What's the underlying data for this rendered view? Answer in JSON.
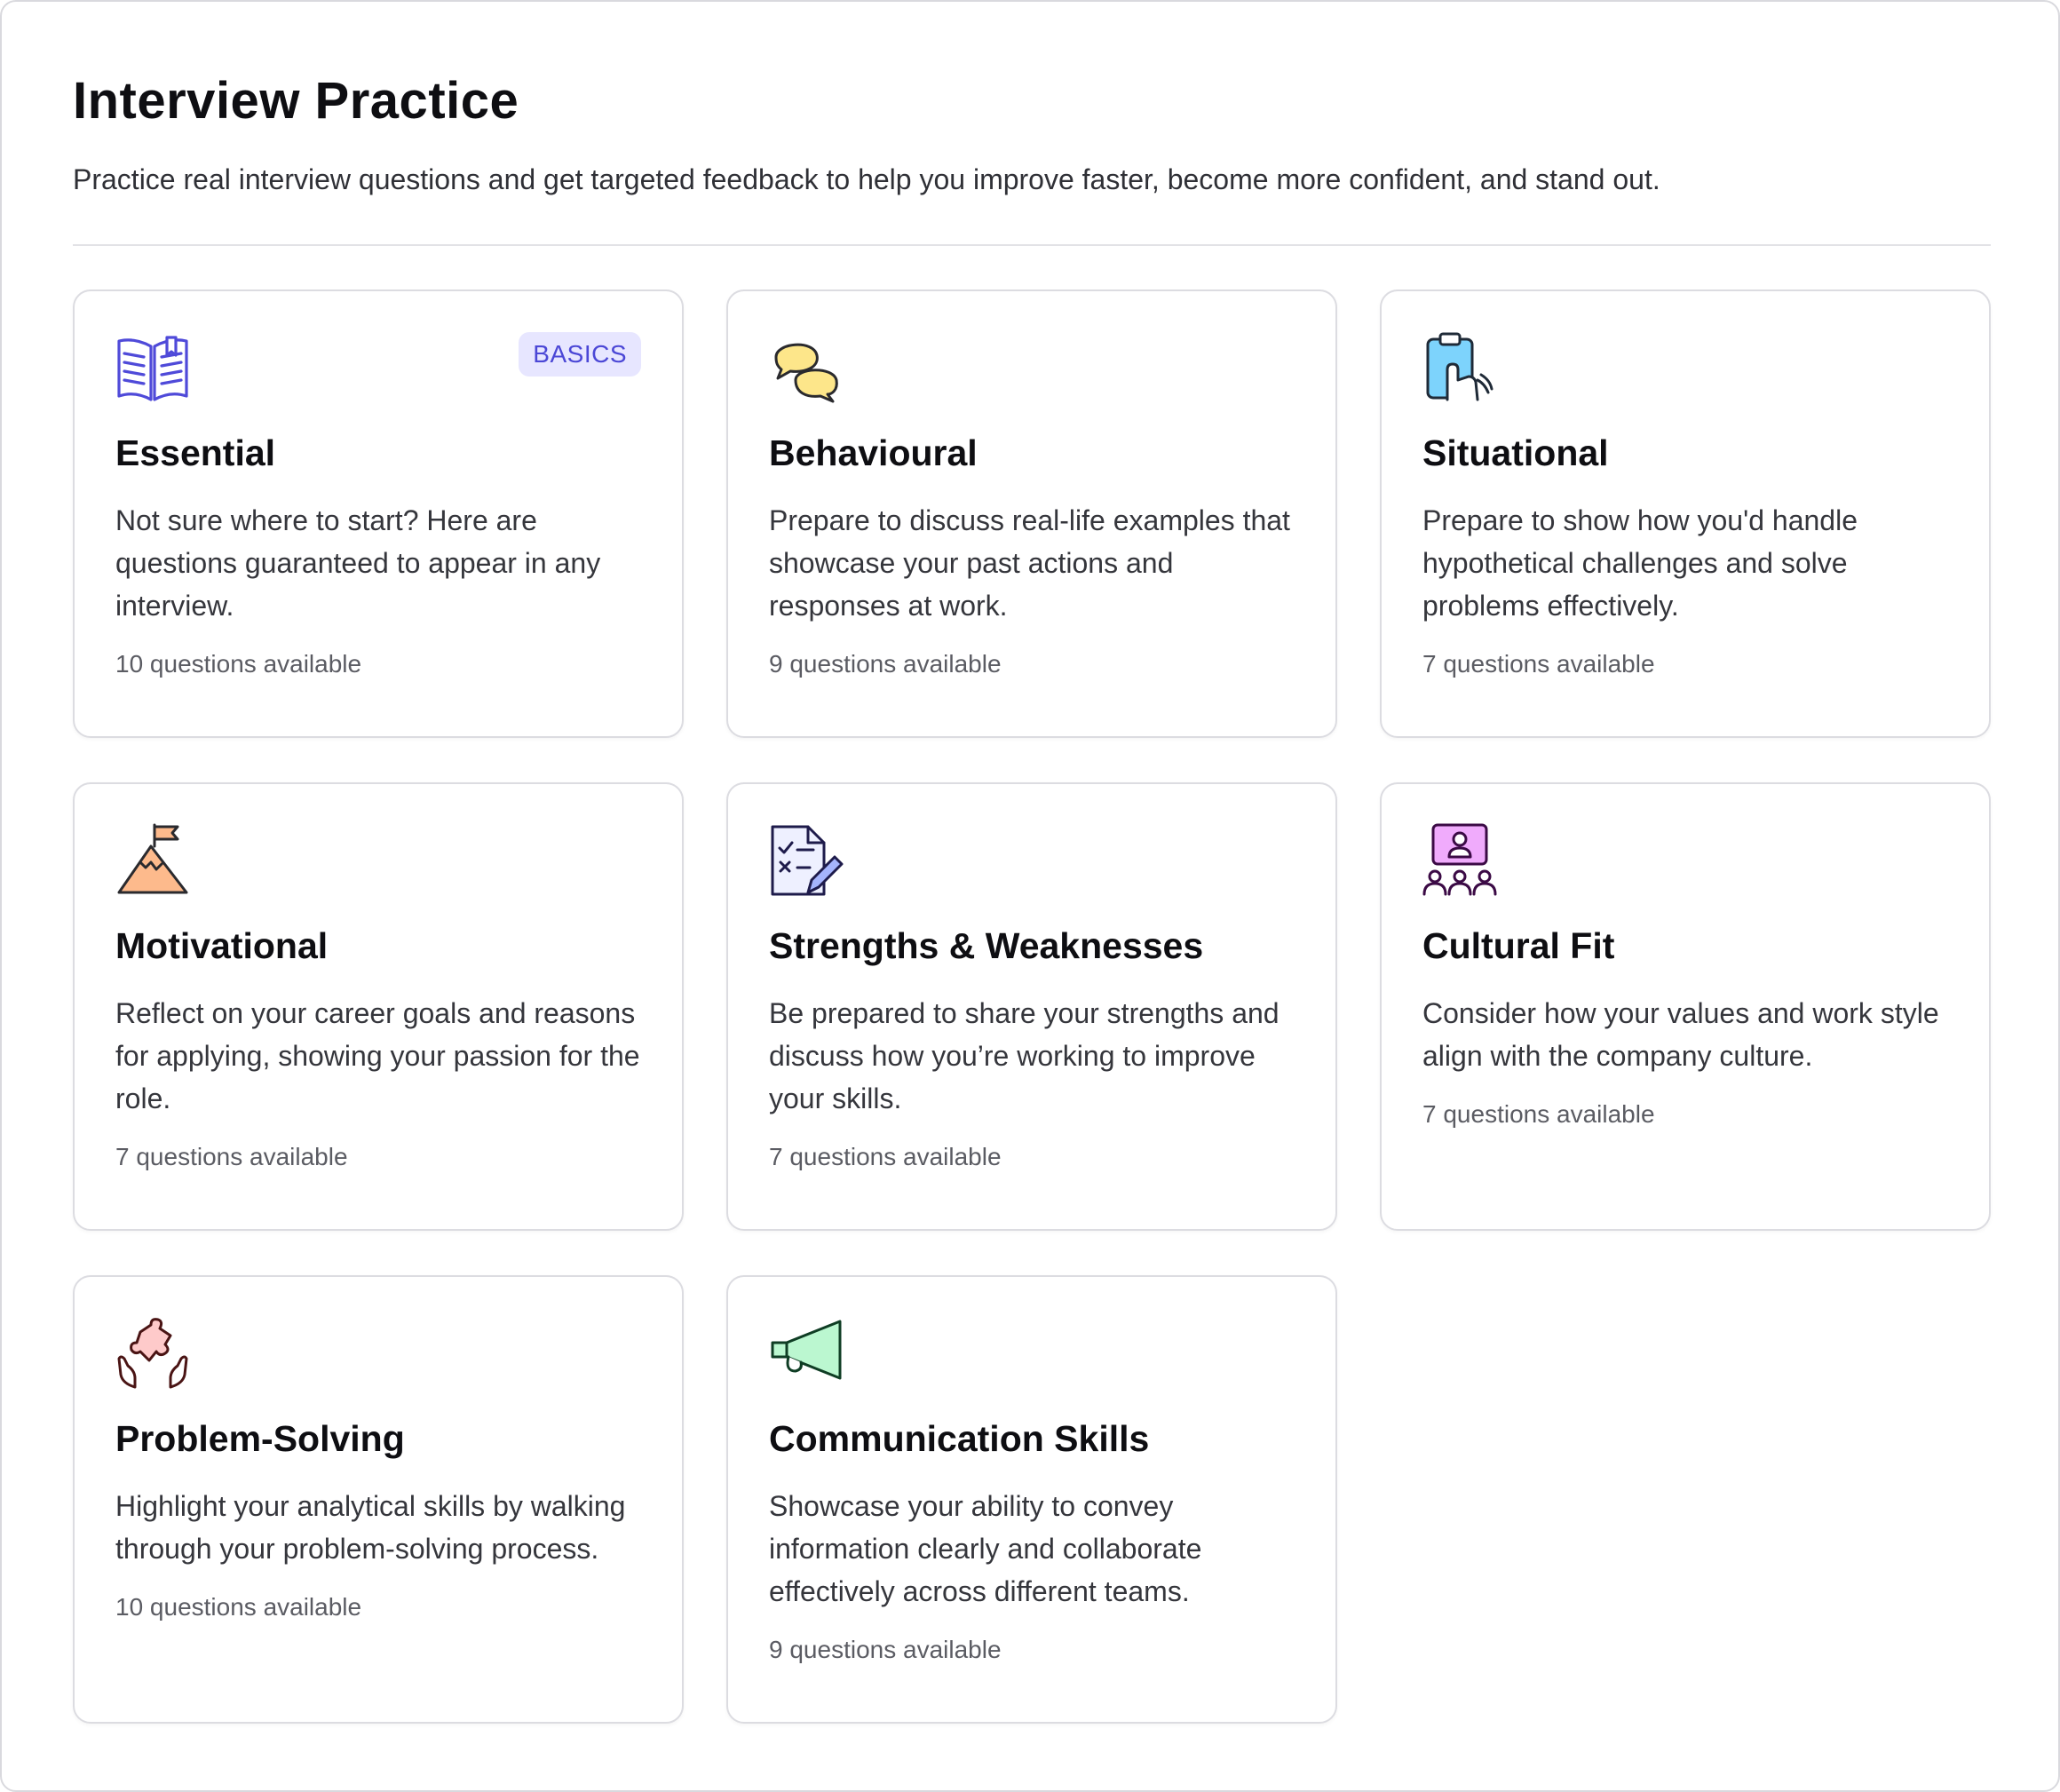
{
  "header": {
    "title": "Interview Practice",
    "subtitle": "Practice real interview questions and get targeted feedback to help you improve faster, become more confident, and stand out."
  },
  "categories": [
    {
      "title": "Essential",
      "badge": "BASICS",
      "icon": "open-book-icon",
      "description": "Not sure where to start? Here are questions guaranteed to appear in any interview.",
      "count_label": "10 questions available"
    },
    {
      "title": "Behavioural",
      "icon": "speech-bubbles-icon",
      "description": "Prepare to discuss real-life examples that showcase your past actions and responses at work.",
      "count_label": "9 questions available"
    },
    {
      "title": "Situational",
      "icon": "clipboard-hand-icon",
      "description": "Prepare to show how you'd handle hypothetical challenges and solve problems effectively.",
      "count_label": "7 questions available"
    },
    {
      "title": "Motivational",
      "icon": "mountain-flag-icon",
      "description": "Reflect on your career goals and reasons for applying, showing your passion for the role.",
      "count_label": "7 questions available"
    },
    {
      "title": "Strengths & Weaknesses",
      "icon": "checklist-pen-icon",
      "description": "Be prepared to share your strengths and discuss how you’re working to improve your skills.",
      "count_label": "7 questions available"
    },
    {
      "title": "Cultural Fit",
      "icon": "team-presentation-icon",
      "description": "Consider how your values and work style align with the company culture.",
      "count_label": "7 questions available"
    },
    {
      "title": "Problem-Solving",
      "icon": "puzzle-hands-icon",
      "description": "Highlight your analytical skills by walking through your problem-solving process.",
      "count_label": "10 questions available"
    },
    {
      "title": "Communication Skills",
      "icon": "megaphone-icon",
      "description": "Showcase your ability to convey information clearly and collaborate effectively across different teams.",
      "count_label": "9 questions available"
    }
  ],
  "colors": {
    "badge_bg": "#e7e6ff",
    "badge_text": "#4b47d6",
    "card_border": "#dcdce1"
  }
}
